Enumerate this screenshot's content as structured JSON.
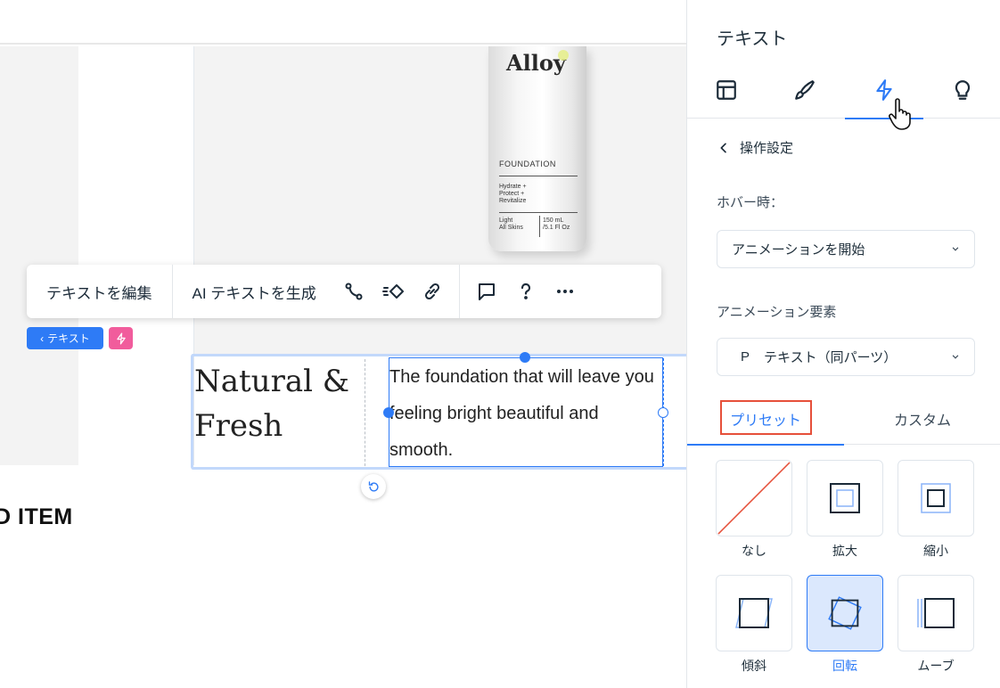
{
  "canvas": {
    "product": {
      "brand": "Alloy",
      "type": "FOUNDATION",
      "benefits": "Hydrate +\nProtect +\nRevitalize",
      "shade": "Light\nAll Skins",
      "volume": "150 mL\n/5.1 Fl Oz"
    },
    "toolbar": {
      "edit_text_label": "テキストを編集",
      "ai_generate_label": "AI テキストを生成"
    },
    "breadcrumb_tag": "テキスト",
    "heading": "Natural & Fresh",
    "body": "The foundation that will leave you feeling bright beautiful and smooth.",
    "item_label": "D ITEM"
  },
  "panel": {
    "title": "テキスト",
    "tabs": [
      {
        "icon": "layout-icon"
      },
      {
        "icon": "brush-icon"
      },
      {
        "icon": "lightning-icon",
        "active": true
      },
      {
        "icon": "lightbulb-icon"
      }
    ],
    "back_label": "操作設定",
    "hover_label": "ホバー時：",
    "hover_action": "アニメーションを開始",
    "animation_element_label": "アニメーション要素",
    "animation_element_prefix": "P",
    "animation_element": "テキスト（同パーツ）",
    "subtabs": {
      "preset": "プリセット",
      "custom": "カスタム",
      "active": "preset"
    },
    "presets": [
      {
        "label": "なし"
      },
      {
        "label": "拡大"
      },
      {
        "label": "縮小"
      },
      {
        "label": "傾斜"
      },
      {
        "label": "回転",
        "selected": true
      },
      {
        "label": "ムーブ"
      }
    ]
  },
  "colors": {
    "accent": "#2e7bf6",
    "highlight": "#e6503a",
    "interaction_tag": "#f15c9c"
  }
}
